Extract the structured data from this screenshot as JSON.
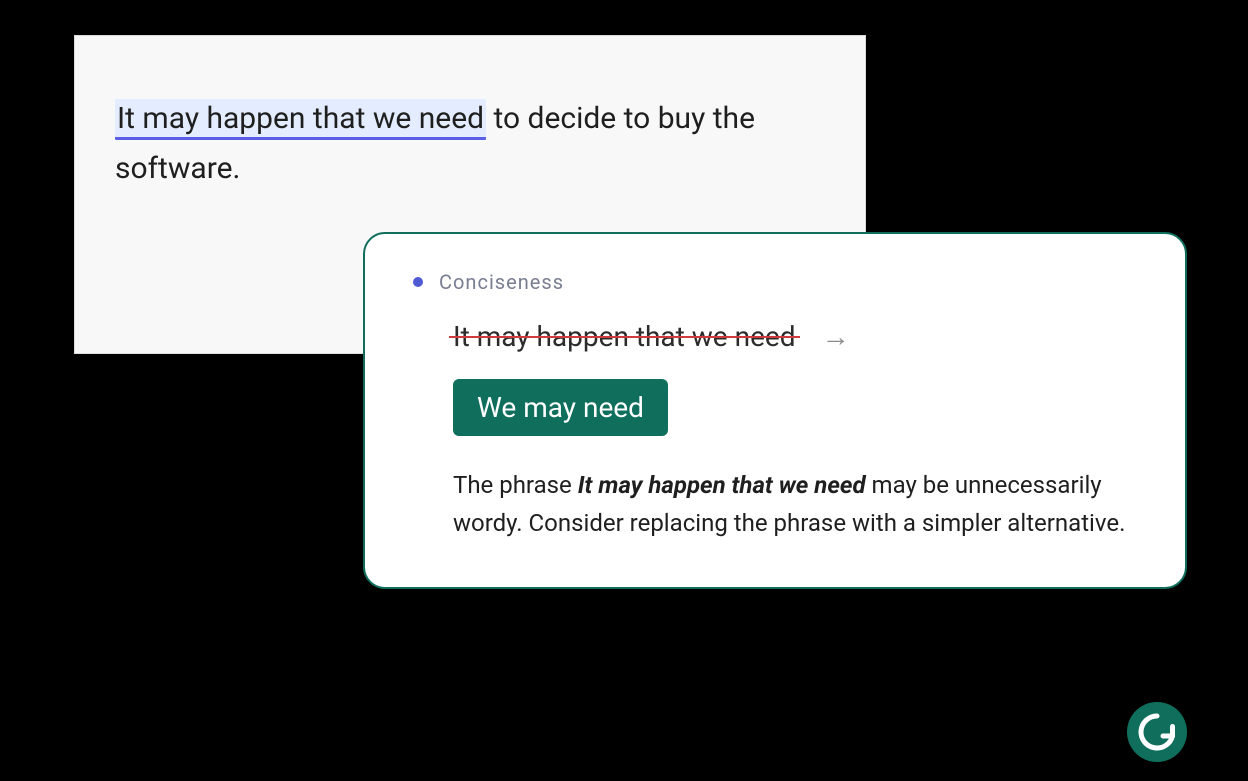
{
  "editor": {
    "highlighted_phrase": "It may happen that we need",
    "rest_of_sentence": " to decide to buy the software."
  },
  "suggestion": {
    "category": "Conciseness",
    "original_text": "It may happen that we need",
    "replacement_text": "We may need",
    "explanation_prefix": "The phrase ",
    "explanation_bold": "It may happen that we need",
    "explanation_suffix": " may be unnecessarily wordy. Consider replacing the phrase with a simpler alternative."
  },
  "brand": {
    "logo_letter": "G"
  }
}
